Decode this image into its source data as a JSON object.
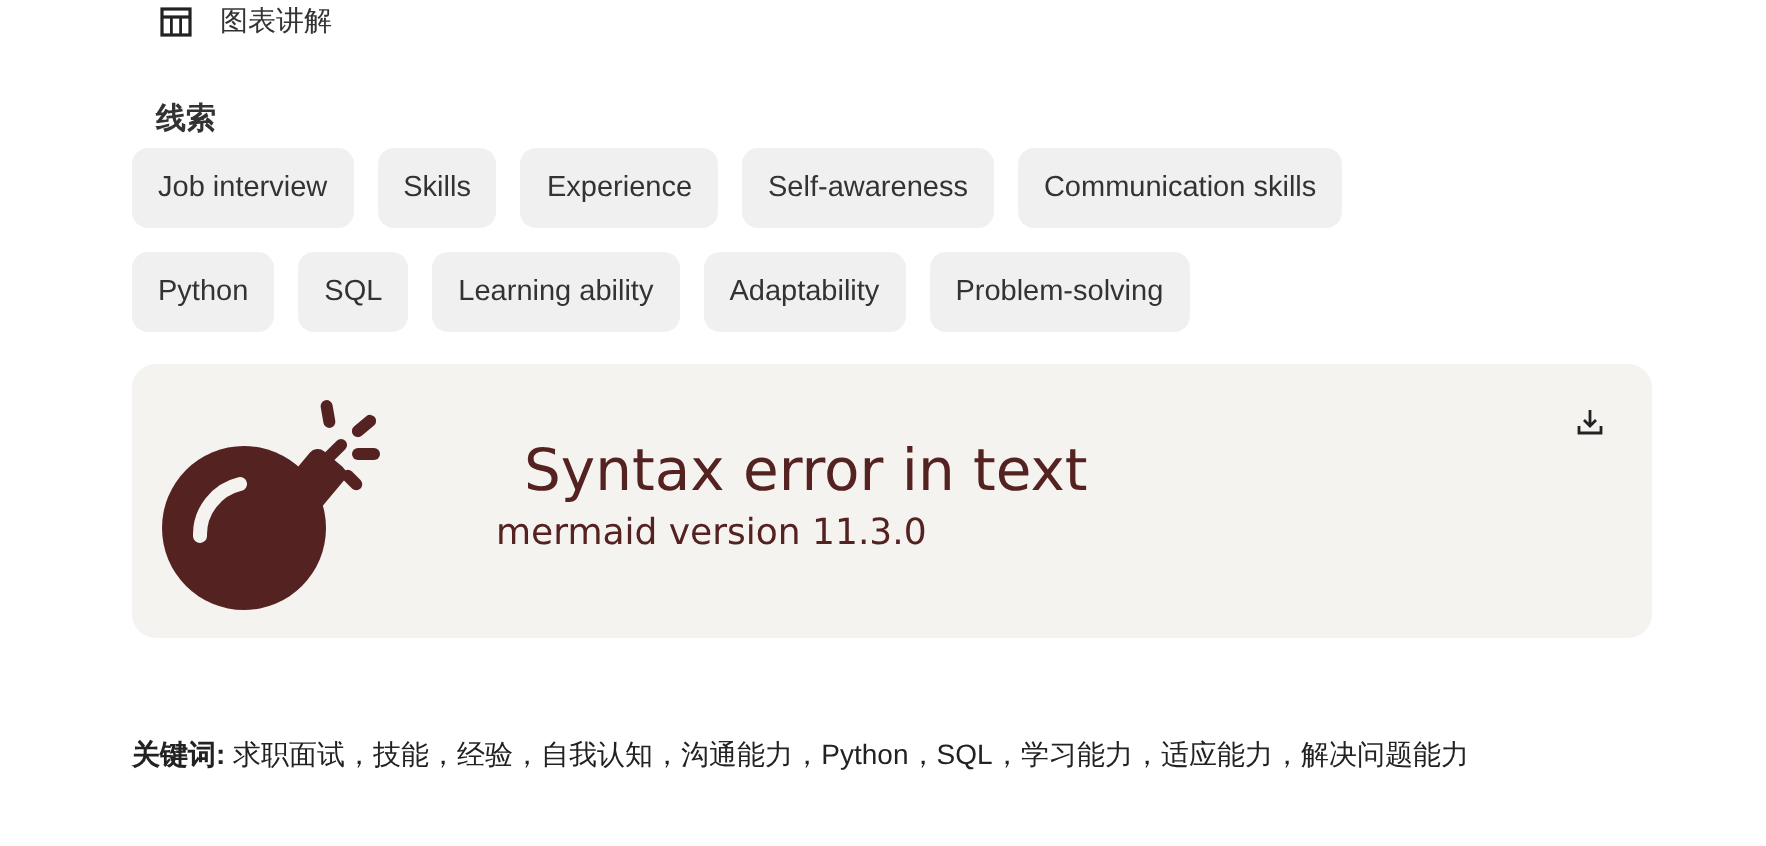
{
  "header": {
    "label": "图表讲解"
  },
  "clues": {
    "title": "线索",
    "tag_rows": [
      [
        "Job interview",
        "Skills",
        "Experience",
        "Self-awareness",
        "Communication skills"
      ],
      [
        "Python",
        "SQL",
        "Learning ability",
        "Adaptability",
        "Problem-solving"
      ]
    ]
  },
  "diagram_error": {
    "title": "Syntax error in text",
    "version": "mermaid version 11.3.0"
  },
  "keywords": {
    "label": "关键词:",
    "text": "求职面试，技能，经验，自我认知，沟通能力，Python，SQL，学习能力，适应能力，解决问题能力"
  }
}
